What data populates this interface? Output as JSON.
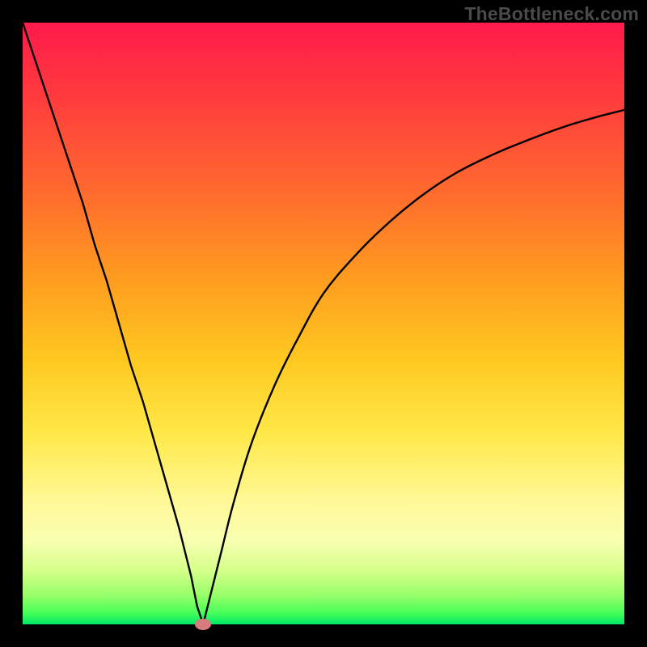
{
  "watermark": "TheBottleneck.com",
  "colors": {
    "frame": "#000000",
    "watermark": "#4a4a4a",
    "curve_stroke": "#000000",
    "marker_fill": "#d97a7d",
    "gradient_top": "#ff1a4b",
    "gradient_bottom": "#00e865"
  },
  "chart_data": {
    "type": "line",
    "title": "",
    "xlabel": "",
    "ylabel": "",
    "xlim": [
      0,
      100
    ],
    "ylim": [
      0,
      100
    ],
    "grid": false,
    "legend": false,
    "series": [
      {
        "name": "bottleneck-curve",
        "x": [
          0,
          2,
          4,
          6,
          8,
          10,
          12,
          14,
          16,
          18,
          20,
          22,
          24,
          26,
          28,
          29,
          30,
          31,
          33,
          35,
          38,
          42,
          46,
          50,
          55,
          60,
          66,
          72,
          78,
          84,
          90,
          95,
          100
        ],
        "values": [
          100,
          94,
          88,
          82,
          76,
          70,
          63,
          57,
          50,
          43,
          37,
          30,
          23,
          16,
          8,
          3,
          0,
          4,
          12,
          20,
          30,
          40,
          48,
          55,
          61,
          66,
          71,
          75,
          78,
          80.5,
          82.7,
          84.2,
          85.5
        ]
      }
    ],
    "marker": {
      "x": 30,
      "y": 0
    },
    "annotations": []
  }
}
